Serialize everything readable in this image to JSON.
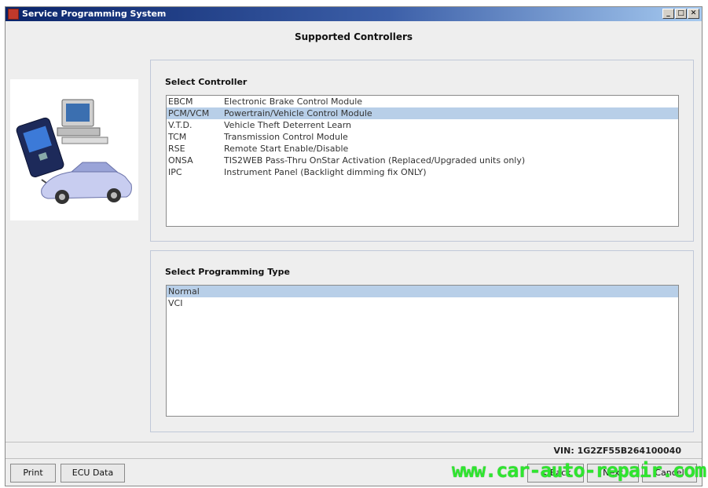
{
  "window": {
    "title": "Service Programming System",
    "minimize_glyph": "_",
    "maximize_glyph": "□",
    "close_glyph": "✕"
  },
  "page_heading": "Supported Controllers",
  "controllers": {
    "label": "Select Controller",
    "items": [
      {
        "code": "EBCM",
        "description": "Electronic Brake Control Module",
        "selected": false
      },
      {
        "code": "PCM/VCM",
        "description": "Powertrain/Vehicle Control Module",
        "selected": true
      },
      {
        "code": "V.T.D.",
        "description": "Vehicle Theft Deterrent Learn",
        "selected": false
      },
      {
        "code": "TCM",
        "description": "Transmission Control Module",
        "selected": false
      },
      {
        "code": "RSE",
        "description": "Remote Start Enable/Disable",
        "selected": false
      },
      {
        "code": "ONSA",
        "description": "TIS2WEB Pass-Thru OnStar Activation (Replaced/Upgraded units only)",
        "selected": false
      },
      {
        "code": "IPC",
        "description": "Instrument Panel (Backlight dimming fix ONLY)",
        "selected": false
      }
    ]
  },
  "programming_type": {
    "label": "Select Programming Type",
    "items": [
      {
        "label": "Normal",
        "selected": true
      },
      {
        "label": "VCI",
        "selected": false
      }
    ]
  },
  "status": {
    "vin": "VIN: 1G2ZF55B264100040"
  },
  "buttons": {
    "print": "Print",
    "ecu_data": "ECU Data",
    "back": "< Back",
    "next": "Next",
    "cancel": "Cancel"
  },
  "watermark": "www.car-auto-repair.com",
  "colors": {
    "titlebar": "#0a246a",
    "selection": "#b8cfe8",
    "watermark": "#2ee62e"
  }
}
